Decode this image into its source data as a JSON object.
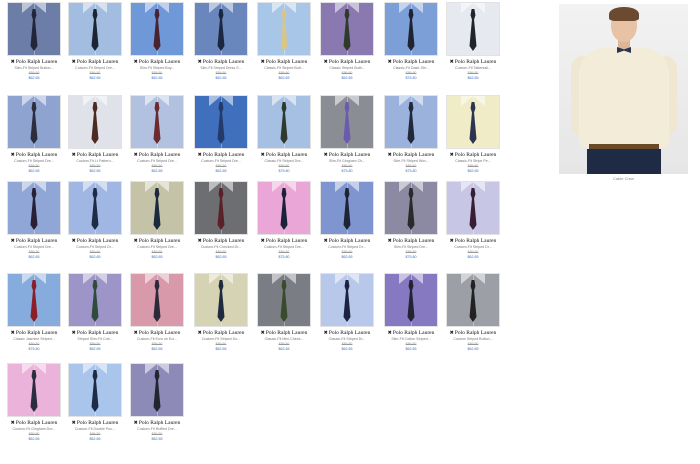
{
  "brand": "Polo Ralph Lauren",
  "brand_icon": "polo-pony-icon",
  "products": [
    {
      "name": "Slim-Fit Striped Button...",
      "old": "$89.50",
      "price": "$62.65",
      "shirt": "#6c7ea8",
      "tie": "#222638"
    },
    {
      "name": "Custom-Fit Striped Dre...",
      "old": "$89.50",
      "price": "$62.65",
      "shirt": "#a3bde0",
      "tie": "#1d2433"
    },
    {
      "name": "Slim-Fit Striped Buy...",
      "old": "$89.50",
      "price": "$62.65",
      "shirt": "#6f98d8",
      "tie": "#4a2330"
    },
    {
      "name": "Slim-Fit Striped Dress S...",
      "old": "$89.50",
      "price": "$62.65",
      "shirt": "#6986bd",
      "tie": "#1b2740"
    },
    {
      "name": "Classic-Fit Striped Butt...",
      "old": "$89.50",
      "price": "$62.65",
      "shirt": "#a8c6e8",
      "tie": "#d7c68a"
    },
    {
      "name": "Classic Striped Buttt...",
      "old": "$89.50",
      "price": "$62.65",
      "shirt": "#8a78b0",
      "tie": "#2f3a2a"
    },
    {
      "name": "Classic-Fit Dash-Stri...",
      "old": "$89.50",
      "price": "$75.80",
      "shirt": "#7d9fd8",
      "tie": "#1f2430"
    },
    {
      "name": "Custom-Fit Tattersall...",
      "old": "$89.50",
      "price": "$62.65",
      "shirt": "#e6e9f0",
      "tie": "#20242c"
    },
    {
      "name": "Custom-Fit Striped Dre...",
      "old": "$89.50",
      "price": "$62.65",
      "shirt": "#8ea3cf",
      "tie": "#2c2e3d"
    },
    {
      "name": "Custom-Fit Lt Pattern...",
      "old": "$89.50",
      "price": "$62.65",
      "shirt": "#dfe2e8",
      "tie": "#4c2a22"
    },
    {
      "name": "Custom-Fit Striped Dre...",
      "old": "$89.50",
      "price": "$62.65",
      "shirt": "#b2c1df",
      "tie": "#6a2a2e"
    },
    {
      "name": "Custom-Fit Striped Dre...",
      "old": "$89.50",
      "price": "$62.65",
      "shirt": "#3f6fbd",
      "tie": "#233a6a"
    },
    {
      "name": "Classic-Fit Striped Dre...",
      "old": "$89.50",
      "price": "$75.80",
      "shirt": "#a6c0e4",
      "tie": "#2f3a2f"
    },
    {
      "name": "Slim-Fit Gingham Ch...",
      "old": "$89.50",
      "price": "$75.80",
      "shirt": "#8a8d94",
      "tie": "#6a5ab0"
    },
    {
      "name": "Slim-Fit Striped Wov...",
      "old": "$89.50",
      "price": "$75.80",
      "shirt": "#9ab2dc",
      "tie": "#22283a"
    },
    {
      "name": "Classic-Fit Stripe Pe...",
      "old": "$89.50",
      "price": "$62.65",
      "shirt": "#f0ecc8",
      "tie": "#2d3450"
    },
    {
      "name": "Custom-Fit Striped Dre...",
      "old": "$89.50",
      "price": "$62.65",
      "shirt": "#8fa6d6",
      "tie": "#2a2035"
    },
    {
      "name": "Custom-Fit Striped Dr...",
      "old": "$89.50",
      "price": "$62.65",
      "shirt": "#9fb7e2",
      "tie": "#1f2a44"
    },
    {
      "name": "Custom-Fit Striped Dre...",
      "old": "$89.50",
      "price": "$62.65",
      "shirt": "#c4c3a8",
      "tie": "#1d2a3d"
    },
    {
      "name": "Custom-Fit Checked Dr...",
      "old": "$89.50",
      "price": "$62.65",
      "shirt": "#6d6e72",
      "tie": "#5a2228"
    },
    {
      "name": "Custom-Fit Striped Dre...",
      "old": "$89.50",
      "price": "$75.80",
      "shirt": "#e9a6d6",
      "tie": "#1a2238"
    },
    {
      "name": "Custom-Fit Striped Dr...",
      "old": "$89.50",
      "price": "$62.65",
      "shirt": "#7e95d0",
      "tie": "#1e2336"
    },
    {
      "name": "Slim-Fit Striped Dre...",
      "old": "$89.50",
      "price": "$75.80",
      "shirt": "#8b8aa2",
      "tie": "#2a2a2a"
    },
    {
      "name": "Custom-Fit Striped Dr...",
      "old": "$89.50",
      "price": "$62.65",
      "shirt": "#c7c6e4",
      "tie": "#3a1e35"
    },
    {
      "name": "Classic Jasmine Striped...",
      "old": "$89.50",
      "price": "$75.80",
      "shirt": "#86acde",
      "tie": "#8c1e2a"
    },
    {
      "name": "Striped Slim-Fit Cott...",
      "old": "$89.50",
      "price": "$62.65",
      "shirt": "#9d95c8",
      "tie": "#2f4b3c"
    },
    {
      "name": "Custom-Fit Ecru on Ecr...",
      "old": "$89.50",
      "price": "$62.65",
      "shirt": "#d89aaa",
      "tie": "#2a2a3a"
    },
    {
      "name": "Custom-Fit Striped Do...",
      "old": "$89.50",
      "price": "$62.65",
      "shirt": "#d5d3b3",
      "tie": "#1e2a3e"
    },
    {
      "name": "Classic-Fit Mini-Check...",
      "old": "$89.50",
      "price": "$62.65",
      "shirt": "#7a7d83",
      "tie": "#3a4a2c"
    },
    {
      "name": "Classic-Fit Striped Dr...",
      "old": "$89.50",
      "price": "$62.65",
      "shirt": "#b7c8ea",
      "tie": "#1b2340"
    },
    {
      "name": "Slim-Fit Cotton Striped...",
      "old": "$89.50",
      "price": "$62.65",
      "shirt": "#8778c2",
      "tie": "#222431"
    },
    {
      "name": "Custom Striped Button...",
      "old": "$89.50",
      "price": "$62.65",
      "shirt": "#9d9fa6",
      "tie": "#222222"
    },
    {
      "name": "Custom-Fit Gingham Dre...",
      "old": "$89.50",
      "price": "$62.65",
      "shirt": "#ebb2da",
      "tie": "#2a2d40"
    },
    {
      "name": "Custom-Fit Double Poc...",
      "old": "$89.50",
      "price": "$62.65",
      "shirt": "#a9c5ec",
      "tie": "#1f2b44"
    },
    {
      "name": "Custom-Fit Ruffled Dre...",
      "old": "$89.50",
      "price": "$62.65",
      "shirt": "#8d8ab8",
      "tie": "#222630"
    }
  ],
  "promo": {
    "caption": "Cable Crew"
  }
}
